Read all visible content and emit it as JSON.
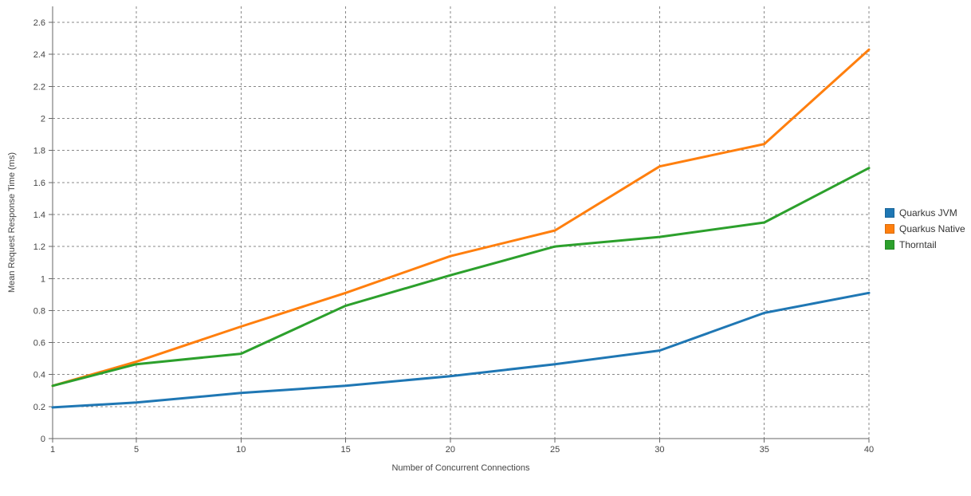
{
  "chart_data": {
    "type": "line",
    "title": "",
    "xlabel": "Number of Concurrent Connections",
    "ylabel": "Mean Request Response Time (ms)",
    "x": [
      1,
      5,
      10,
      15,
      20,
      25,
      30,
      35,
      40
    ],
    "xticks": [
      1,
      5,
      10,
      15,
      20,
      25,
      30,
      35,
      40
    ],
    "yticks": [
      0,
      0.2,
      0.4,
      0.6,
      0.8,
      1,
      1.2,
      1.4,
      1.6,
      1.8,
      2,
      2.2,
      2.4,
      2.6
    ],
    "xlim": [
      1,
      40
    ],
    "ylim": [
      0,
      2.7
    ],
    "grid": true,
    "legend_position": "right",
    "series": [
      {
        "name": "Quarkus JVM",
        "color": "#1f77b4",
        "values": [
          0.195,
          0.225,
          0.285,
          0.33,
          0.39,
          0.465,
          0.55,
          0.785,
          0.91
        ]
      },
      {
        "name": "Quarkus Native",
        "color": "#ff7f0e",
        "values": [
          0.33,
          0.48,
          0.7,
          0.91,
          1.14,
          1.3,
          1.7,
          1.84,
          2.43
        ]
      },
      {
        "name": "Thorntail",
        "color": "#2ca02c",
        "values": [
          0.33,
          0.465,
          0.53,
          0.83,
          1.02,
          1.2,
          1.26,
          1.35,
          1.69
        ]
      }
    ]
  },
  "colors": {
    "blue": "#1f77b4",
    "orange": "#ff7f0e",
    "green": "#2ca02c"
  }
}
